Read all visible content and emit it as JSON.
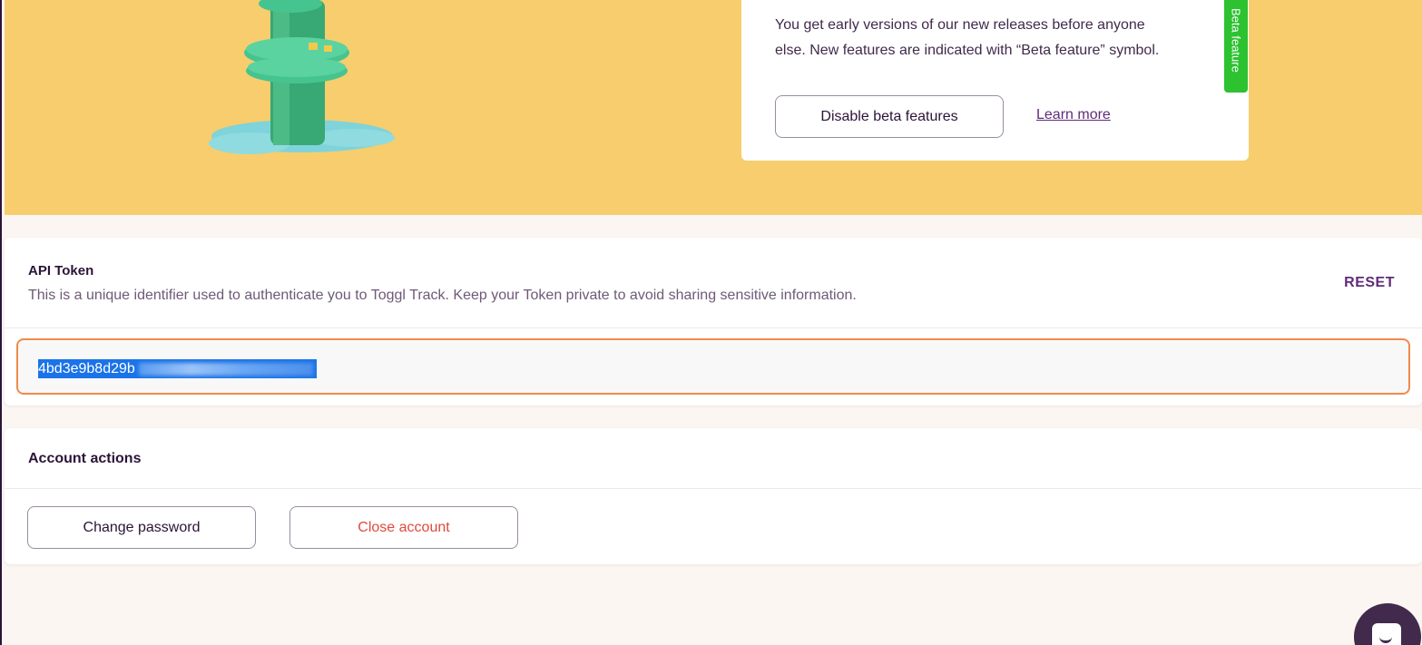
{
  "beta": {
    "description_line1": "You get early versions of our new releases before anyone",
    "description_line2": "else. New features are indicated with “Beta feature” symbol.",
    "disable_label": "Disable beta features",
    "learn_more_label": "Learn more",
    "tag_label": "Beta feature"
  },
  "api_token": {
    "title": "API Token",
    "description": "This is a unique identifier used to authenticate you to Toggl Track. Keep your Token private to avoid sharing sensitive information.",
    "reset_label": "RESET",
    "token_visible": "4bd3e9b8d29b"
  },
  "account_actions": {
    "title": "Account actions",
    "change_password_label": "Change password",
    "close_account_label": "Close account"
  },
  "colors": {
    "banner": "#f7cd6e",
    "accent": "#5f2c7a",
    "beta_tag": "#2cc230",
    "danger": "#e0493b",
    "focus_border": "#f08a4c"
  },
  "icons": [
    "beta-illustration",
    "chat-icon"
  ]
}
